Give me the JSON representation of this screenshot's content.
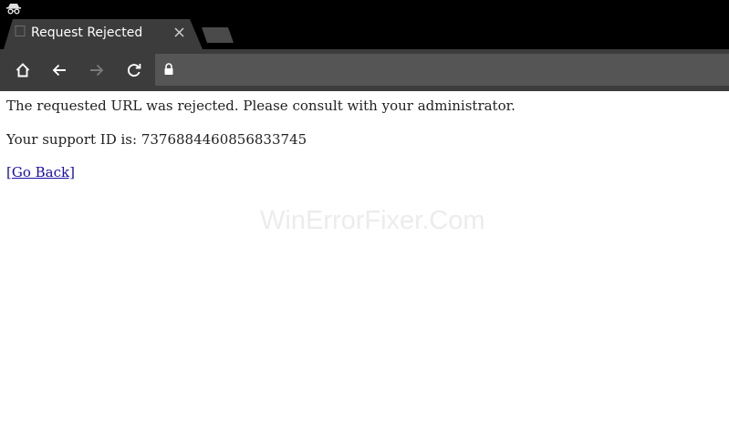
{
  "browser": {
    "tab": {
      "title": "Request Rejected"
    },
    "omnibox": {
      "url": ""
    }
  },
  "page": {
    "message": "The requested URL was rejected. Please consult with your administrator.",
    "support_id_text": "Your support ID is: 7376884460856833745",
    "go_back_label": "[Go Back]",
    "watermark": "WinErrorFixer.Com"
  },
  "colors": {
    "tabstrip": "#000000",
    "toolbar": "#3c3c3c",
    "omnibox": "#555555",
    "link": "#1a0dab"
  }
}
